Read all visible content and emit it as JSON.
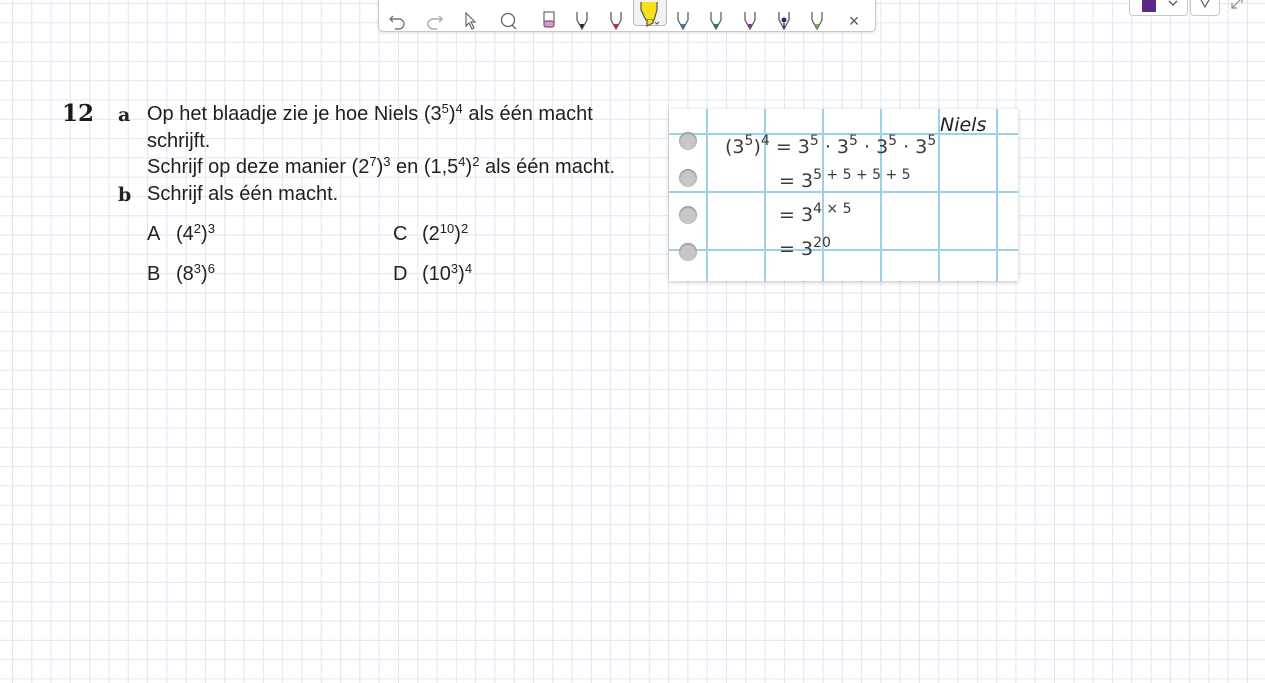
{
  "toolbar": {
    "tools": [
      "undo-icon",
      "redo-icon",
      "pointer-icon",
      "lasso-icon",
      "eraser-icon",
      "pen-black-icon",
      "pen-red-icon",
      "highlighter-yellow-icon",
      "pen-blue-icon",
      "pen-green-icon",
      "pen-purple-icon",
      "pen-navy-icon",
      "pen-lightgreen-icon",
      "close-icon"
    ],
    "close_label": "×",
    "active_color": "#5b2a86"
  },
  "exercise": {
    "number": "12",
    "a_label": "a",
    "a_line1_pre": "Op het blaadje zie je hoe Niels (3",
    "a_line1_sup1": "5",
    "a_line1_mid": ")",
    "a_line1_sup2": "4",
    "a_line1_post": " als één macht",
    "a_line2": "schrijft.",
    "a_line3_pre": "Schrijf op deze manier (2",
    "a_line3_sup1": "7",
    "a_line3_mid1": ")",
    "a_line3_sup2": "3",
    "a_line3_mid2": " en (1,5",
    "a_line3_sup3": "4",
    "a_line3_mid3": ")",
    "a_line3_sup4": "2",
    "a_line3_post": " als één macht.",
    "b_label": "b",
    "b_line": "Schrijf als één macht.",
    "options": [
      {
        "letter": "A",
        "base": "(4",
        "exp1": "2",
        "close": ")",
        "exp2": "3"
      },
      {
        "letter": "B",
        "base": "(8",
        "exp1": "3",
        "close": ")",
        "exp2": "6"
      },
      {
        "letter": "C",
        "base": "(2",
        "exp1": "10",
        "close": ")",
        "exp2": "2"
      },
      {
        "letter": "D",
        "base": "(10",
        "exp1": "3",
        "close": ")",
        "exp2": "4"
      }
    ]
  },
  "notebook": {
    "author": "Niels",
    "line1": {
      "lhs_base": "(3",
      "lhs_e1": "5",
      "lhs_close": ")",
      "lhs_e2": "4",
      "rhs": "= 3",
      "e": "5",
      "rest": " · 3",
      "e2": "5",
      "rest2": " · 3",
      "e3": "5",
      "rest3": " · 3",
      "e4": "5"
    },
    "line2": {
      "eq": "= 3",
      "exp": "5 + 5 + 5 + 5"
    },
    "line3": {
      "eq": "= 3",
      "exp": "4 × 5"
    },
    "line4": {
      "eq": "= 3",
      "exp": "20"
    }
  }
}
